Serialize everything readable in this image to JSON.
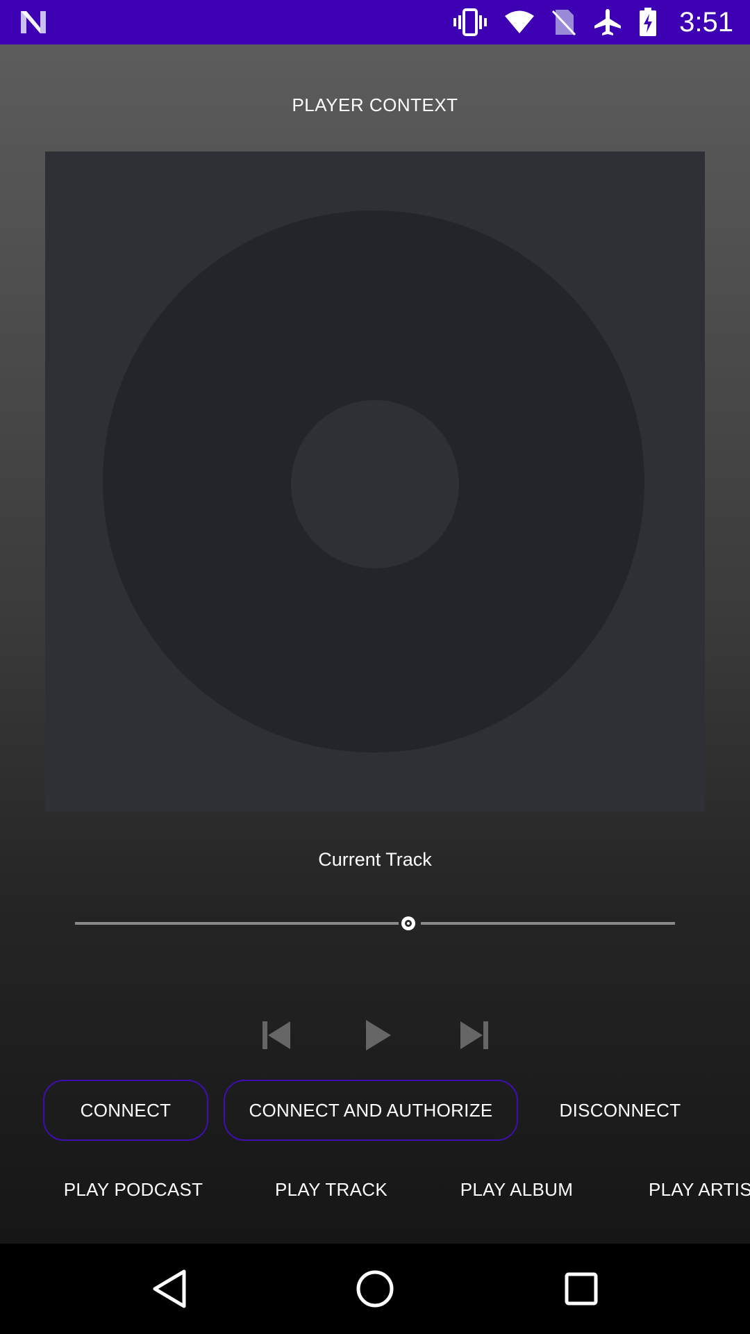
{
  "status_bar": {
    "time": "3:51",
    "icons": [
      "notification-n-icon",
      "vibrate-icon",
      "wifi-icon",
      "no-sim-icon",
      "airplane-mode-icon",
      "battery-charging-icon"
    ],
    "background": "#3d00b3"
  },
  "player": {
    "context_label": "PLAYER CONTEXT",
    "cover_art_icon": "disc-placeholder-icon",
    "current_track": "Current Track",
    "seek_progress_fraction": 0.54,
    "controls": [
      "skip-previous-icon",
      "play-icon",
      "skip-next-icon"
    ]
  },
  "buttons": {
    "connect": "CONNECT",
    "connect_authorize": "CONNECT AND AUTHORIZE",
    "disconnect": "DISCONNECT",
    "play_podcast": "PLAY PODCAST",
    "play_track": "PLAY TRACK",
    "play_album": "PLAY ALBUM",
    "play_artist": "PLAY ARTIST"
  },
  "nav_bar": {
    "icons": [
      "back-icon",
      "home-icon",
      "recents-icon"
    ]
  },
  "colors": {
    "accent": "#3d0fb0",
    "cover_bg": "#2f3035",
    "disc": "#24252a"
  }
}
